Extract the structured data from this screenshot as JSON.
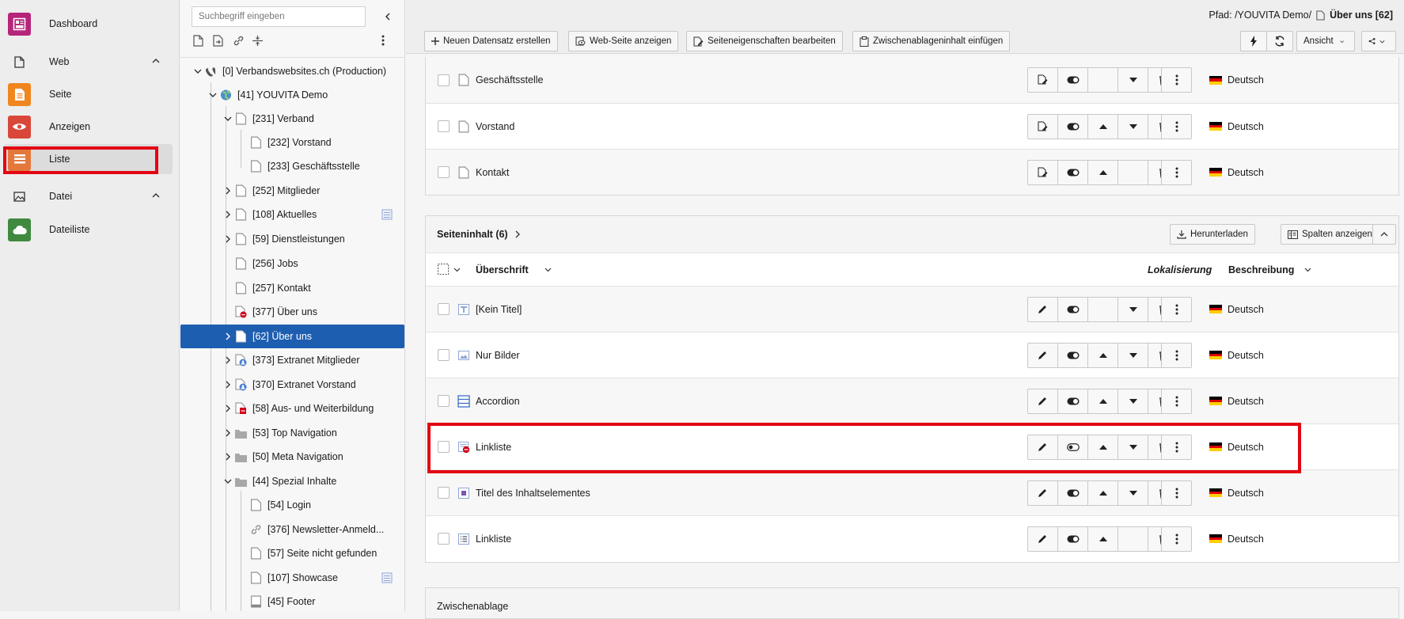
{
  "module_menu": {
    "dashboard": "Dashboard",
    "web_group": "Web",
    "seite": "Seite",
    "anzeigen": "Anzeigen",
    "liste": "Liste",
    "datei_group": "Datei",
    "dateiliste": "Dateiliste"
  },
  "tree": {
    "search_placeholder": "Suchbegriff eingeben",
    "items": [
      "[0] Verbandswebsites.ch (Production)",
      "[41] YOUVITA Demo",
      "[231] Verband",
      "[232] Vorstand",
      "[233] Geschäftsstelle",
      "[252] Mitglieder",
      "[108] Aktuelles",
      "[59] Dienstleistungen",
      "[256] Jobs",
      "[257] Kontakt",
      "[377] Über uns",
      "[62] Über uns",
      "[373] Extranet Mitglieder",
      "[370] Extranet Vorstand",
      "[58] Aus- und Weiterbildung",
      "[53] Top Navigation",
      "[50] Meta Navigation",
      "[44] Spezial Inhalte",
      "[54] Login",
      "[376] Newsletter-Anmeld...",
      "[57] Seite nicht gefunden",
      "[107] Showcase",
      "[45] Footer"
    ]
  },
  "toolbar": {
    "new_record": "Neuen Datensatz erstellen",
    "view_page": "Web-Seite anzeigen",
    "edit_props": "Seiteneigenschaften bearbeiten",
    "paste_clipboard": "Zwischenablageninhalt einfügen",
    "ansicht": "Ansicht"
  },
  "path": {
    "label": "Pfad: /YOUVITA Demo/",
    "page": "Über uns [62]"
  },
  "pages_table": {
    "rows": [
      {
        "title": "Geschäftsstelle",
        "lang": "Deutsch"
      },
      {
        "title": "Vorstand",
        "lang": "Deutsch"
      },
      {
        "title": "Kontakt",
        "lang": "Deutsch"
      }
    ]
  },
  "content_table": {
    "title": "Seiteninhalt (6)",
    "download": "Herunterladen",
    "show_columns": "Spalten anzeigen",
    "col_header": "Überschrift",
    "col_localization": "Lokalisierung",
    "col_description": "Beschreibung",
    "rows": [
      {
        "title": "[Kein Titel]",
        "lang": "Deutsch"
      },
      {
        "title": "Nur Bilder",
        "lang": "Deutsch"
      },
      {
        "title": "Accordion",
        "lang": "Deutsch"
      },
      {
        "title": "Linkliste",
        "lang": "Deutsch"
      },
      {
        "title": "Titel des Inhaltselementes",
        "lang": "Deutsch"
      },
      {
        "title": "Linkliste",
        "lang": "Deutsch"
      }
    ]
  },
  "clipboard": {
    "title": "Zwischenablage"
  },
  "colors": {
    "selected": "#1e5eb1",
    "highlight": "#e30613",
    "dashboard": "#b5267b",
    "seite": "#f0861f",
    "anzeigen": "#d9473a",
    "liste": "#e3783a",
    "dateiliste": "#3f8a3f"
  }
}
